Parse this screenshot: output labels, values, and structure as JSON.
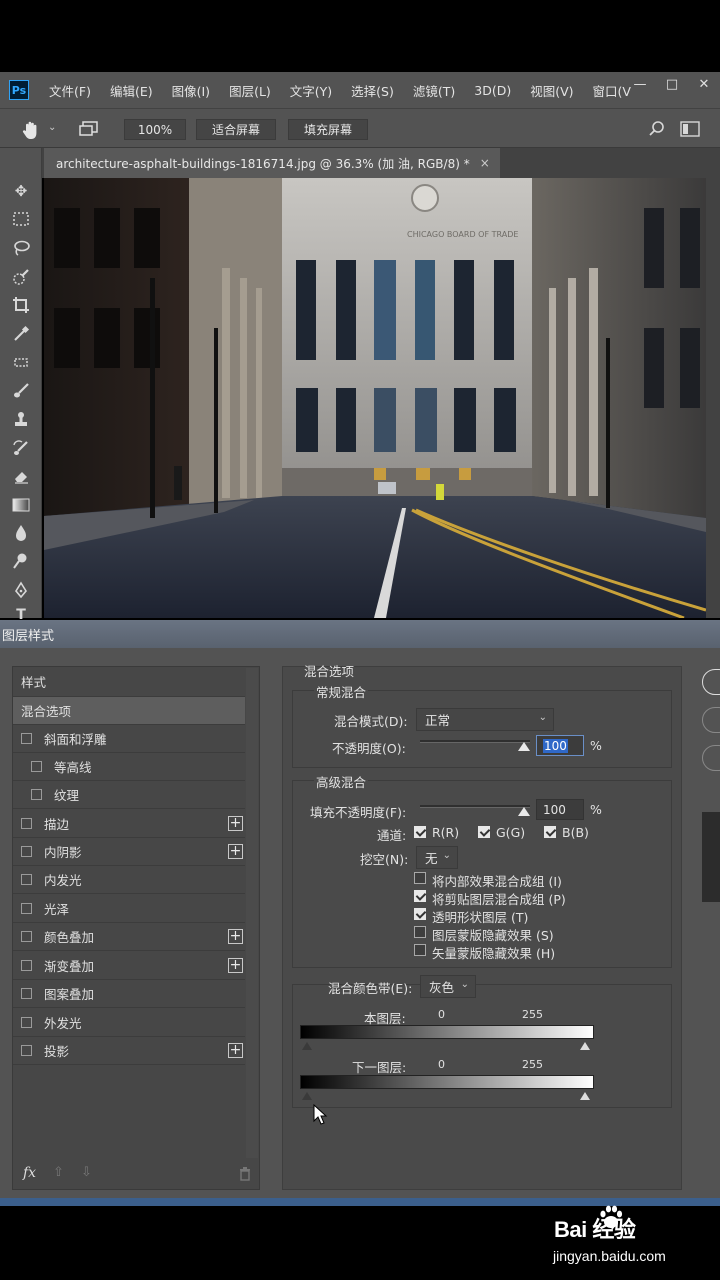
{
  "app": {
    "logo": "Ps"
  },
  "menu": [
    "文件(F)",
    "编辑(E)",
    "图像(I)",
    "图层(L)",
    "文字(Y)",
    "选择(S)",
    "滤镜(T)",
    "3D(D)",
    "视图(V)",
    "窗口(V"
  ],
  "window_controls": {
    "minimize": "—",
    "restore": "□",
    "close": "✕"
  },
  "options_bar": {
    "zoom": "100%",
    "fit_screen": "适合屏幕",
    "fill_screen": "填充屏幕"
  },
  "document_tab": {
    "title": "architecture-asphalt-buildings-1816714.jpg @ 36.3% (加 油, RGB/8) *",
    "close": "×"
  },
  "photo": {
    "sign": "CHICAGO BOARD OF TRADE"
  },
  "dialog": {
    "title": "图层样式",
    "styles_header": "样式",
    "styles": [
      {
        "label": "混合选项",
        "checkbox": false,
        "plus": false,
        "selected": true,
        "indent": 0
      },
      {
        "label": "斜面和浮雕",
        "checkbox": true,
        "plus": false,
        "selected": false,
        "indent": 0
      },
      {
        "label": "等高线",
        "checkbox": true,
        "plus": false,
        "selected": false,
        "indent": 1
      },
      {
        "label": "纹理",
        "checkbox": true,
        "plus": false,
        "selected": false,
        "indent": 1
      },
      {
        "label": "描边",
        "checkbox": true,
        "plus": true,
        "selected": false,
        "indent": 0
      },
      {
        "label": "内阴影",
        "checkbox": true,
        "plus": true,
        "selected": false,
        "indent": 0
      },
      {
        "label": "内发光",
        "checkbox": true,
        "plus": false,
        "selected": false,
        "indent": 0
      },
      {
        "label": "光泽",
        "checkbox": true,
        "plus": false,
        "selected": false,
        "indent": 0
      },
      {
        "label": "颜色叠加",
        "checkbox": true,
        "plus": true,
        "selected": false,
        "indent": 0
      },
      {
        "label": "渐变叠加",
        "checkbox": true,
        "plus": true,
        "selected": false,
        "indent": 0
      },
      {
        "label": "图案叠加",
        "checkbox": true,
        "plus": false,
        "selected": false,
        "indent": 0
      },
      {
        "label": "外发光",
        "checkbox": true,
        "plus": false,
        "selected": false,
        "indent": 0
      },
      {
        "label": "投影",
        "checkbox": true,
        "plus": true,
        "selected": false,
        "indent": 0
      }
    ],
    "footer": {
      "fx": "fx",
      "up": "⇧",
      "down": "⇩",
      "trash": "🗑"
    },
    "blend_options": {
      "section_title": "混合选项",
      "general": {
        "title": "常规混合",
        "mode_label": "混合模式(D):",
        "mode_value": "正常",
        "opacity_label": "不透明度(O):",
        "opacity_value": "100",
        "opacity_unit": "%"
      },
      "advanced": {
        "title": "高级混合",
        "fill_label": "填充不透明度(F):",
        "fill_value": "100",
        "fill_unit": "%",
        "channels_label": "通道:",
        "channels": [
          {
            "label": "R(R)",
            "checked": true
          },
          {
            "label": "G(G)",
            "checked": true
          },
          {
            "label": "B(B)",
            "checked": true
          }
        ],
        "knockout_label": "挖空(N):",
        "knockout_value": "无",
        "options": [
          {
            "label": "将内部效果混合成组 (I)",
            "checked": false
          },
          {
            "label": "将剪贴图层混合成组 (P)",
            "checked": true
          },
          {
            "label": "透明形状图层 (T)",
            "checked": true
          },
          {
            "label": "图层蒙版隐藏效果 (S)",
            "checked": false
          },
          {
            "label": "矢量蒙版隐藏效果 (H)",
            "checked": false
          }
        ]
      },
      "blend_if": {
        "label": "混合颜色带(E):",
        "value": "灰色",
        "this_layer": "本图层:",
        "underlying_layer": "下一图层:",
        "min": "0",
        "max": "255"
      }
    }
  },
  "watermark": {
    "brand": "Bai  经验",
    "url": "jingyan.baidu.com"
  }
}
